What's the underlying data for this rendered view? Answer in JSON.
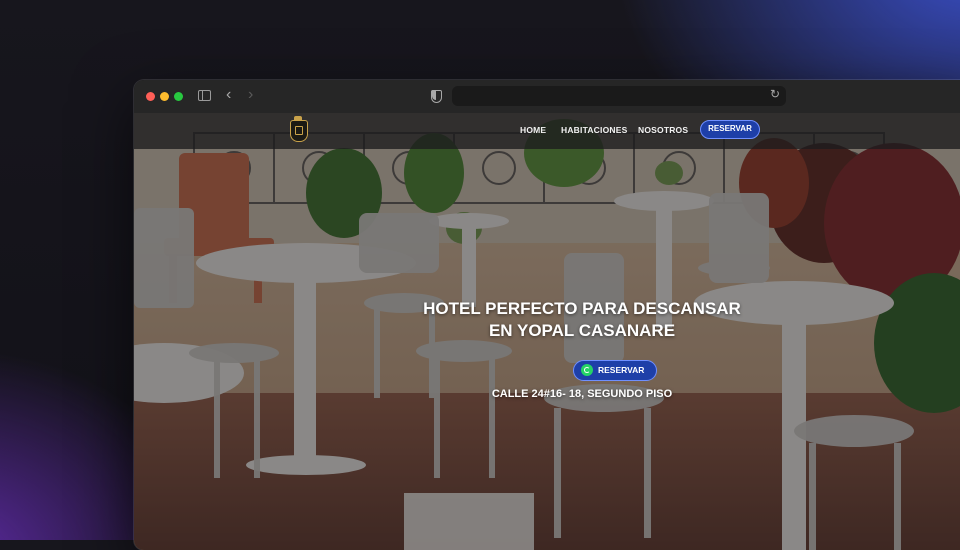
{
  "browser": {
    "url": ""
  },
  "site_nav": {
    "links": [
      "HOME",
      "HABITACIONES",
      "NOSOTROS"
    ],
    "cta_label": "RESERVAR"
  },
  "hero": {
    "title_line1": "HOTEL PERFECTO PARA DESCANSAR",
    "title_line2": "EN YOPAL CASANARE",
    "button_label": "RESERVAR",
    "address": "CALLE 24#16- 18, SEGUNDO PISO"
  },
  "colors": {
    "accent": "#1e3fa8",
    "accent_border": "#6f8fff",
    "whatsapp": "#25d366"
  },
  "icons": [
    "sidebar-toggle-icon",
    "back-arrow-icon",
    "forward-arrow-icon",
    "shield-icon",
    "reload-icon",
    "hotel-logo",
    "whatsapp-icon"
  ]
}
